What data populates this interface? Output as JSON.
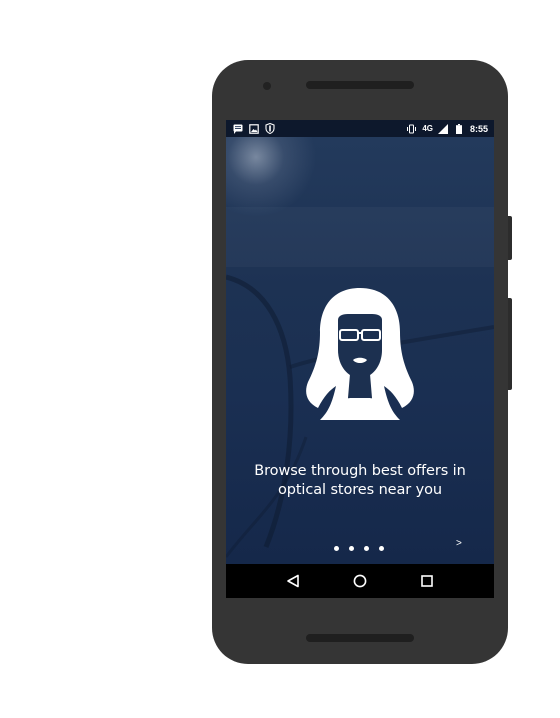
{
  "status_bar": {
    "left_icons": [
      "message-icon",
      "image-icon",
      "shield-icon"
    ],
    "right_icons": [
      "vibrate-icon",
      "signal-icon",
      "battery-icon"
    ],
    "network": "4G",
    "time": "8:55"
  },
  "onboarding": {
    "illustration": "woman-with-glasses-icon",
    "tagline_line1": "Browse through best offers in",
    "tagline_line2": "optical stores near you",
    "page_dots": 4,
    "next_label": ">"
  },
  "nav_bar": {
    "buttons": [
      "back-icon",
      "home-icon",
      "recents-icon"
    ]
  },
  "colors": {
    "phone_body": "#353535",
    "screen_background": "#1b2f4f",
    "nav_bar": "#000000",
    "text": "#ffffff"
  }
}
